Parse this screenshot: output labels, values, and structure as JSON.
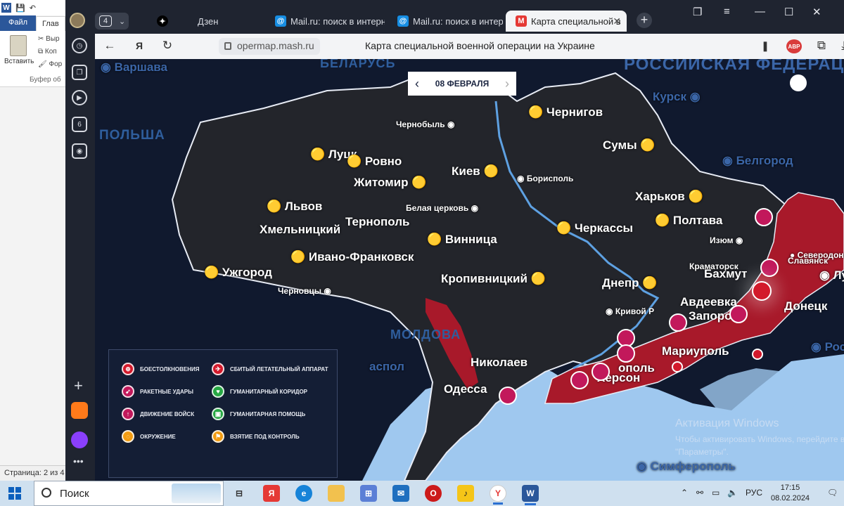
{
  "word": {
    "tab_file": "Файл",
    "tab_home": "Глав",
    "paste_label": "Вставить",
    "cut_label": "Выр",
    "copy_label": "Коп",
    "format_label": "Фор",
    "group_label": "Буфер об",
    "status": "Страница: 2 из 4"
  },
  "browser": {
    "tab_count": "4",
    "tabs": [
      {
        "label": "Дзен",
        "icon": "zen-icon"
      },
      {
        "label": "Mail.ru: поиск в интерн",
        "icon": "mail-icon"
      },
      {
        "label": "Mail.ru: поиск в интерн",
        "icon": "mail-icon"
      },
      {
        "label": "Карта специальной в",
        "icon": "mash-icon"
      }
    ],
    "address": "opermap.mash.ru",
    "page_title": "Карта специальной военной операции на Украине",
    "adblock_label": "ABP",
    "sidebar_badge": "6"
  },
  "map": {
    "date": "08 ФЕВРАЛЯ",
    "countries": {
      "belarus": "БЕЛАРУСЬ",
      "russia": "РОССИЙСКАЯ ФЕДЕРАЦИЯ",
      "poland": "ПОЛЬША",
      "moldova": "МОЛДОВА"
    },
    "foreign_cities": {
      "warsaw": "Варшава",
      "kursk": "Курск",
      "belgorod": "Белгород",
      "rostov": "Росто",
      "simferopol": "Симферополь",
      "tiraspol": "аспол"
    },
    "cities": {
      "chernigov": "Чернигов",
      "chernobyl": "Чернобыль",
      "sumy": "Сумы",
      "lutsk": "Луцк",
      "rovno": "Ровно",
      "kiev": "Киев",
      "borispol": "Борисполь",
      "zhitomir": "Житомир",
      "kharkov": "Харьков",
      "lvov": "Львов",
      "belaya_tserkov": "Белая церковь",
      "poltava": "Полтава",
      "khmelnitsky": "Хмельницкий",
      "ternopol": "Тернополь",
      "cherkassy": "Черкассы",
      "izyum": "Изюм",
      "vinnitsa": "Винница",
      "severodonetsk": "Северодонецк",
      "ivano_frankovsk": "Ивано-Франковск",
      "kramatorsk": "Краматорск",
      "slavyansk": "Славянск",
      "uzhgorod": "Ужгород",
      "bakhmut": "Бахмут",
      "lugansk": "Луганск",
      "kropivnitsky": "Кропивницкий",
      "dnepr": "Днепр",
      "chernovtsy": "Черновцы",
      "avdeevka": "Авдеевка",
      "donetsk": "Донецк",
      "krivoy_rog": "Кривой Р",
      "zaporozhye": "Запоро",
      "mariupol": "Мариуполь",
      "nikolaev": "Николаев",
      "energodar": "ополь",
      "kherson": "Херсон",
      "odessa": "Одесса"
    },
    "legend": [
      {
        "label": "БОЕСТОЛКНОВЕНИЯ",
        "icon": "clash-icon",
        "color": "#d3192b"
      },
      {
        "label": "СБИТЫЙ ЛЕТАТЕЛЬНЫЙ АППАРАТ",
        "icon": "downed-aircraft-icon",
        "color": "#d3192b"
      },
      {
        "label": "РАКЕТНЫЕ УДАРЫ",
        "icon": "missile-icon",
        "color": "#c2185b"
      },
      {
        "label": "ГУМАНИТАРНЫЙ КОРИДОР",
        "icon": "corridor-icon",
        "color": "#27a844"
      },
      {
        "label": "ДВИЖЕНИЕ ВОЙСК",
        "icon": "troops-icon",
        "color": "#c2185b"
      },
      {
        "label": "ГУМАНИТАРНАЯ ПОМОЩЬ",
        "icon": "aid-icon",
        "color": "#27a844"
      },
      {
        "label": "ОКРУЖЕНИЕ",
        "icon": "encirclement-icon",
        "color": "#f39c12"
      },
      {
        "label": "ВЗЯТИЕ ПОД КОНТРОЛЬ",
        "icon": "control-icon",
        "color": "#f39c12"
      }
    ],
    "watermark_title": "Активация Windows",
    "watermark_text": "Чтобы активировать Windows, перейдите в раздел \"Параметры\".",
    "colors": {
      "ukraine": "#23252b",
      "occupied": "#a8192a",
      "sea": "#9fc8ef",
      "land": "#1a2846"
    }
  },
  "taskbar": {
    "search_label": "Поиск",
    "lang": "РУС",
    "time": "17:15",
    "date": "08.02.2024"
  }
}
